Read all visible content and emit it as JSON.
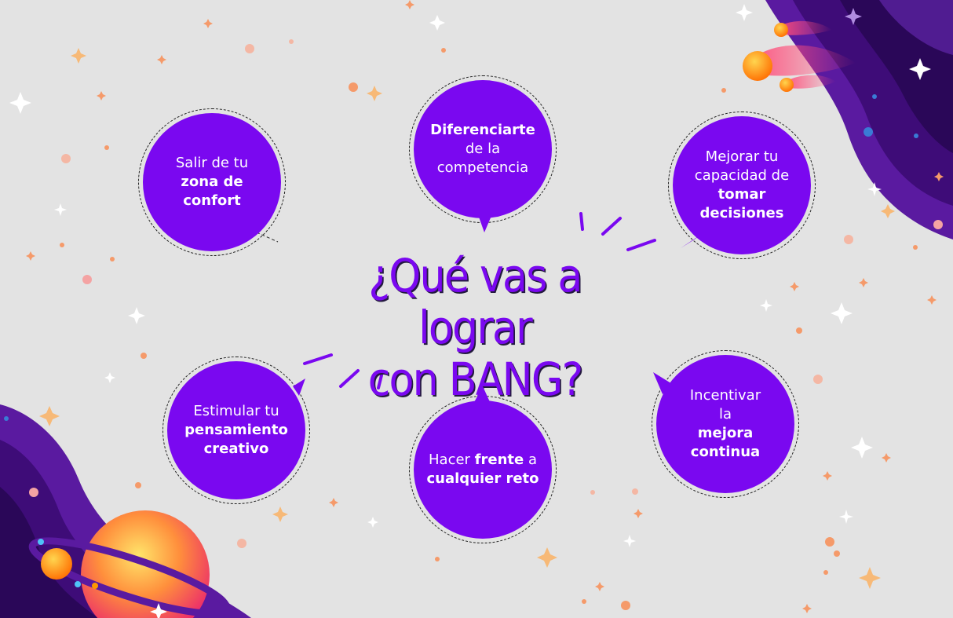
{
  "headline": {
    "line1": "¿Qué vas a lograr",
    "line2": "con BANG?"
  },
  "colors": {
    "background": "#e3e3e3",
    "bubble": "#7a08f0",
    "headline": "#7a08f0",
    "space": "#3a0a6b"
  },
  "bubbles": [
    {
      "pre": "Salir de tu",
      "bold": "zona de confort",
      "post": ""
    },
    {
      "pre": "",
      "bold": "Diferenciarte",
      "post": "de la competencia"
    },
    {
      "pre": "Mejorar tu capacidad de",
      "bold": "tomar decisiones",
      "post": ""
    },
    {
      "pre": "Estimular tu",
      "bold": "pensamiento creativo",
      "post": ""
    },
    {
      "pre": "Hacer",
      "bold": "frente",
      "post": "a",
      "bold2": "cualquier reto"
    },
    {
      "pre": "Incentivar la",
      "bold": "mejora continua",
      "post": ""
    }
  ],
  "decorations": [
    "planet-illustration",
    "comet-illustration",
    "star-icon",
    "sparkle-icon"
  ]
}
